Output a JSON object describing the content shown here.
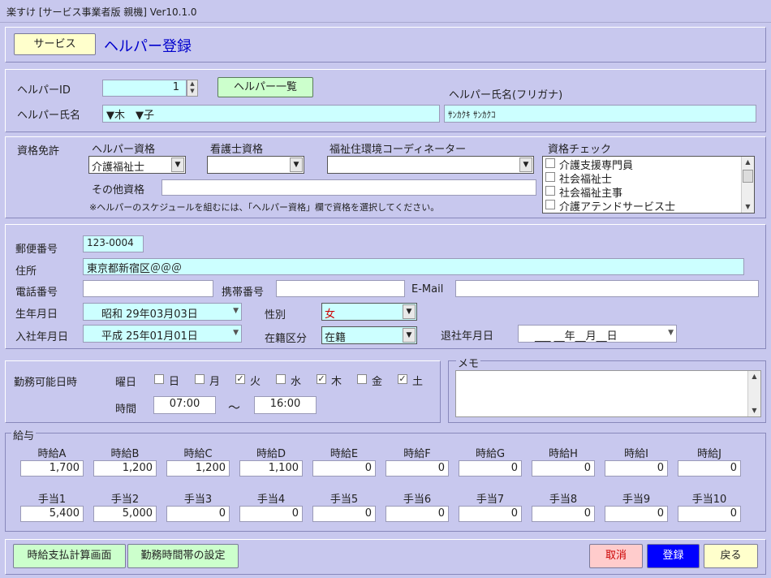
{
  "window": {
    "title": "楽すけ [サービス事業者版 親機] Ver10.1.0"
  },
  "header": {
    "service_button": "サービス",
    "page_title": "ヘルパー登録"
  },
  "helper": {
    "id_label": "ヘルパーID",
    "id_value": "1",
    "list_button": "ヘルパー一覧",
    "name_label": "ヘルパー氏名",
    "name_value": "▼木　▼子",
    "furigana_label": "ヘルパー氏名(フリガナ)",
    "furigana_value": "ｻﾝｶｸｷ ｻﾝｶｸｺ"
  },
  "qualifications": {
    "section_label": "資格免許",
    "helper_qual_label": "ヘルパー資格",
    "helper_qual_value": "介護福祉士",
    "nurse_qual_label": "看護士資格",
    "nurse_qual_value": "",
    "coordinator_label": "福祉住環境コーディネーター",
    "coordinator_value": "",
    "check_label": "資格チェック",
    "check_items": [
      {
        "label": "介護支援専門員",
        "checked": false
      },
      {
        "label": "社会福祉士",
        "checked": false
      },
      {
        "label": "社会福祉主事",
        "checked": false
      },
      {
        "label": "介護アテンドサービス士",
        "checked": false
      }
    ],
    "other_label": "その他資格",
    "other_value": "",
    "note": "※ヘルパーのスケジュールを組むには、「ヘルパー資格」欄で資格を選択してください。"
  },
  "contact": {
    "postal_label": "郵便番号",
    "postal_value": "123-0004",
    "address_label": "住所",
    "address_value": "東京都新宿区＠＠＠",
    "phone_label": "電話番号",
    "phone_value": "",
    "mobile_label": "携帯番号",
    "mobile_value": "",
    "email_label": "E-Mail",
    "email_value": "",
    "birth_label": "生年月日",
    "birth_value": "昭和 29年03月03日",
    "gender_label": "性別",
    "gender_value": "女",
    "join_label": "入社年月日",
    "join_value": "平成 25年01月01日",
    "status_label": "在籍区分",
    "status_value": "在籍",
    "retire_label": "退社年月日",
    "retire_value": "___ __年__月__日"
  },
  "availability": {
    "label": "勤務可能日時",
    "weekday_label": "曜日",
    "days": [
      {
        "label": "日",
        "checked": false
      },
      {
        "label": "月",
        "checked": false
      },
      {
        "label": "火",
        "checked": true
      },
      {
        "label": "水",
        "checked": false
      },
      {
        "label": "木",
        "checked": true
      },
      {
        "label": "金",
        "checked": false
      },
      {
        "label": "土",
        "checked": true
      }
    ],
    "time_label": "時間",
    "start_time": "07:00",
    "tilde": "～",
    "end_time": "16:00"
  },
  "memo": {
    "label": "メモ",
    "value": ""
  },
  "salary": {
    "label": "給与",
    "hourly": [
      {
        "label": "時給A",
        "value": "1,700"
      },
      {
        "label": "時給B",
        "value": "1,200"
      },
      {
        "label": "時給C",
        "value": "1,200"
      },
      {
        "label": "時給D",
        "value": "1,100"
      },
      {
        "label": "時給E",
        "value": "0"
      },
      {
        "label": "時給F",
        "value": "0"
      },
      {
        "label": "時給G",
        "value": "0"
      },
      {
        "label": "時給H",
        "value": "0"
      },
      {
        "label": "時給I",
        "value": "0"
      },
      {
        "label": "時給J",
        "value": "0"
      }
    ],
    "allowances": [
      {
        "label": "手当1",
        "value": "5,400"
      },
      {
        "label": "手当2",
        "value": "5,000"
      },
      {
        "label": "手当3",
        "value": "0"
      },
      {
        "label": "手当4",
        "value": "0"
      },
      {
        "label": "手当5",
        "value": "0"
      },
      {
        "label": "手当6",
        "value": "0"
      },
      {
        "label": "手当7",
        "value": "0"
      },
      {
        "label": "手当8",
        "value": "0"
      },
      {
        "label": "手当9",
        "value": "0"
      },
      {
        "label": "手当10",
        "value": "0"
      }
    ]
  },
  "footer": {
    "hourly_calc_button": "時給支払計算画面",
    "work_hours_button": "勤務時間帯の設定",
    "cancel_button": "取消",
    "register_button": "登録",
    "back_button": "戻る"
  },
  "colors": {
    "background": "#c8c8ee",
    "input_cyan": "#ccffff",
    "title_blue": "#0000cc",
    "service_yellow": "#ffffcc",
    "green_button": "#ccffcc",
    "cancel_pink": "#ffcccc",
    "register_blue": "#0000ff",
    "back_yellow": "#ffffcc"
  }
}
